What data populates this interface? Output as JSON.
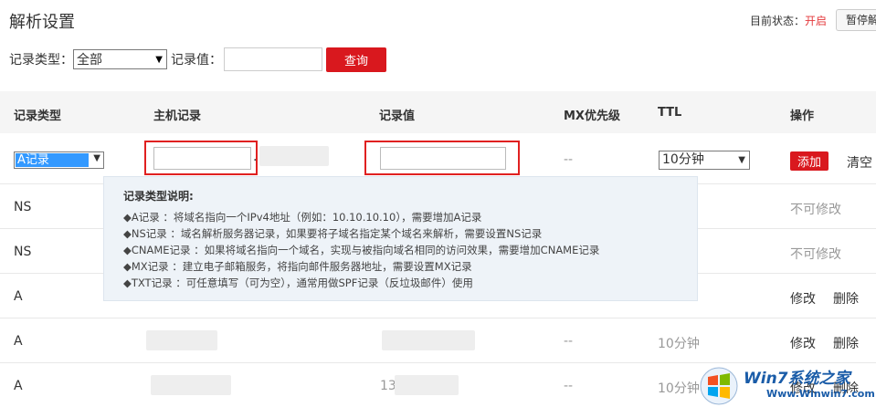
{
  "header": {
    "title": "解析设置",
    "status_label": "目前状态：",
    "status_value": "开启",
    "pause_button": "暂停解析"
  },
  "filter": {
    "type_label": "记录类型：",
    "type_value": "全部",
    "value_label": "记录值：",
    "value_input": "",
    "query_button": "查询"
  },
  "table": {
    "headers": [
      "记录类型",
      "主机记录",
      "记录值",
      "MX优先级",
      "TTL",
      "操作"
    ],
    "edit_row": {
      "type_value": "A记录",
      "host_value": "",
      "host_suffix": ".",
      "record_value": "",
      "mx": "--",
      "ttl_value": "10分钟",
      "add_button": "添加",
      "clear_link": "清空"
    },
    "rows": [
      {
        "type": "NS",
        "op_locked": "不可修改"
      },
      {
        "type": "NS",
        "op_locked": "不可修改"
      },
      {
        "type": "A",
        "edit": "修改",
        "delete": "删除"
      },
      {
        "type": "A",
        "mx": "--",
        "ttl": "10分钟",
        "edit": "修改",
        "delete": "删除"
      },
      {
        "type": "A",
        "value_prefix": "13",
        "mx": "--",
        "ttl": "10分钟",
        "edit": "修改",
        "delete": "删除"
      }
    ]
  },
  "tooltip": {
    "title": "记录类型说明:",
    "lines": [
      "◆A记录 ：将域名指向一个IPv4地址（例如：10.10.10.10），需要增加A记录",
      "◆NS记录 ：域名解析服务器记录，如果要将子域名指定某个域名来解析，需要设置NS记录",
      "◆CNAME记录 ：如果将域名指向一个域名，实现与被指向域名相同的访问效果，需要增加CNAME记录",
      "◆MX记录 ：建立电子邮箱服务，将指向邮件服务器地址，需要设置MX记录",
      "◆TXT记录 ：可任意填写（可为空），通常用做SPF记录（反垃圾邮件）使用"
    ]
  },
  "watermark": {
    "brand": "Win7系统之家",
    "url": "Www.Winwin7.com"
  },
  "colors": {
    "accent_red": "#d9181e",
    "status_red": "#e4393c",
    "select_blue": "#3399ff",
    "tooltip_bg": "#eef3f8"
  }
}
